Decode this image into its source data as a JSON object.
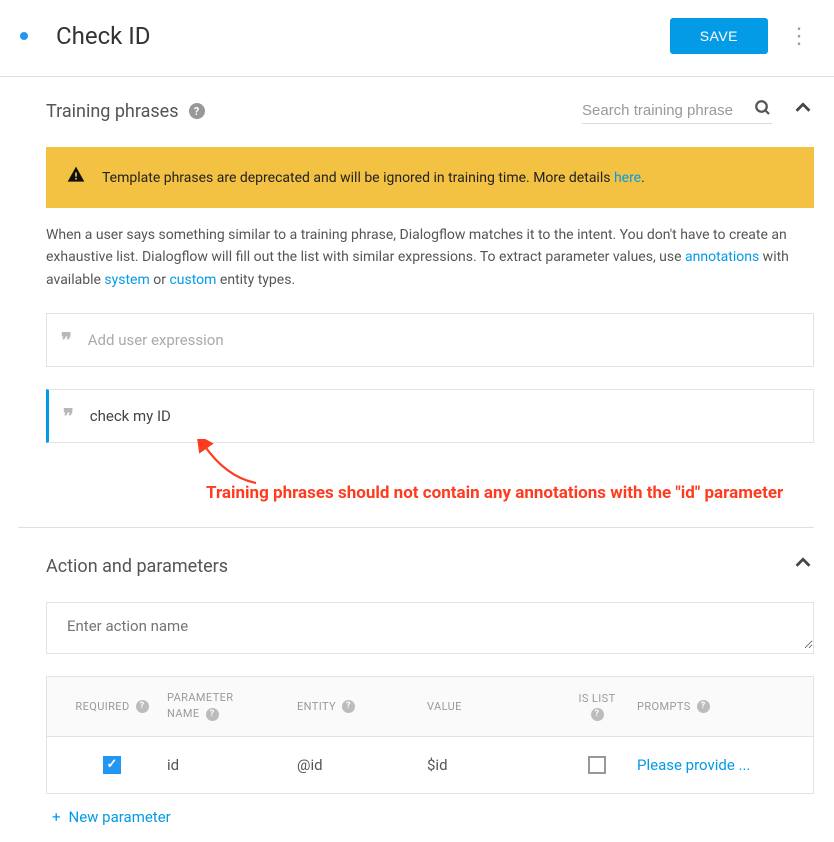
{
  "header": {
    "title": "Check ID",
    "save_label": "SAVE"
  },
  "training": {
    "section_title": "Training phrases",
    "search_placeholder": "Search training phrase",
    "warning_text": "Template phrases are deprecated and will be ignored in training time. More details ",
    "warning_link": "here",
    "desc_1": "When a user says something similar to a training phrase, Dialogflow matches it to the intent. You don't have to create an exhaustive list. Dialogflow will fill out the list with similar expressions. To extract parameter values, use ",
    "link_annotations": "annotations",
    "desc_2": " with available ",
    "link_system": "system",
    "desc_3": " or ",
    "link_custom": "custom",
    "desc_4": " entity types.",
    "add_placeholder": "Add user expression",
    "phrase_1": "check my ID",
    "annotation_callout": "Training phrases should not contain any annotations with the \"id\" parameter"
  },
  "action": {
    "section_title": "Action and parameters",
    "action_name_placeholder": "Enter action name",
    "new_param_label": "New parameter",
    "table": {
      "headers": {
        "required": "REQUIRED",
        "param_name_l1": "PARAMETER",
        "param_name_l2": "NAME",
        "entity": "ENTITY",
        "value": "VALUE",
        "is_list": "IS LIST",
        "prompts": "PROMPTS"
      },
      "row": {
        "required": true,
        "name": "id",
        "entity": "@id",
        "value": "$id",
        "is_list": false,
        "prompt": "Please provide ..."
      }
    }
  }
}
